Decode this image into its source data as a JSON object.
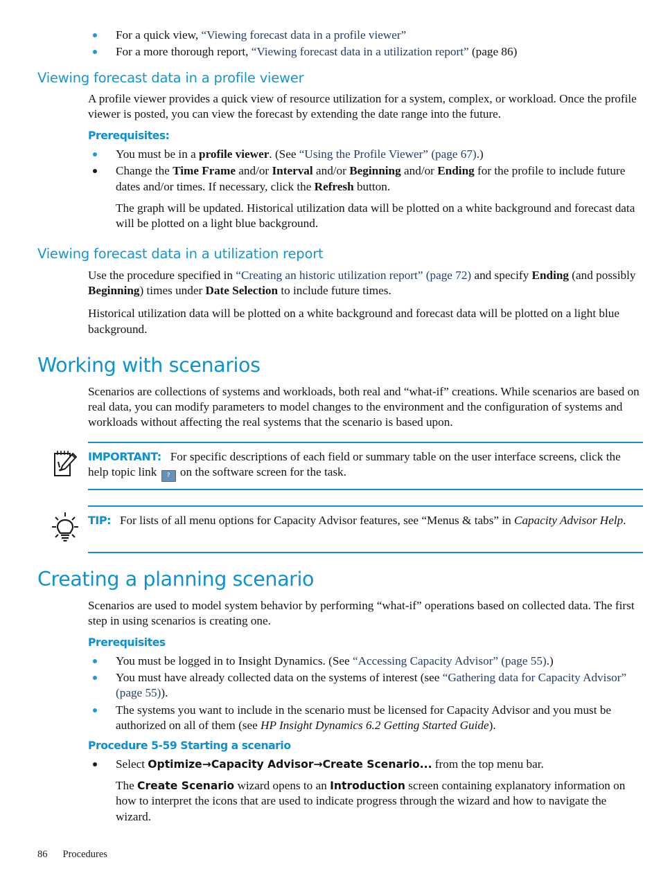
{
  "page": {
    "footer_page_number": "86",
    "footer_chapter": "Procedures"
  },
  "colors": {
    "heading_blue": "#0d92d2",
    "subheading_blue": "#1695d4",
    "link_navy": "#24406b",
    "bullet_blue": "#1e9ad6",
    "rule_blue": "#0e8fd0",
    "body_black": "#141414"
  },
  "intro_bullets": {
    "item1_prefix": "For a quick view, ",
    "item1_link": "“Viewing forecast data in a profile viewer”",
    "item2_prefix": "For a more thorough report, ",
    "item2_link": "“Viewing forecast data in a utilization report”",
    "item2_suffix": " (page 86)"
  },
  "section_profile_viewer": {
    "heading": "Viewing forecast data in a profile viewer",
    "paragraph": "A profile viewer provides a quick view of resource utilization for a system, complex, or workload. Once the profile viewer is posted, you can view the forecast by extending the date range into the future.",
    "prereq_heading": "Prerequisites:",
    "bullet1_a": "You must be in a ",
    "bullet1_b": "profile viewer",
    "bullet1_c": ". (See ",
    "bullet1_link": "“Using the Profile Viewer” (page 67)",
    "bullet1_d": ".)",
    "bullet2_a": "Change the ",
    "bullet2_b1": "Time Frame",
    "bullet2_c1": " and/or ",
    "bullet2_b2": "Interval",
    "bullet2_c2": " and/or ",
    "bullet2_b3": "Beginning",
    "bullet2_c3": " and/or ",
    "bullet2_b4": "Ending",
    "bullet2_d": " for the profile to include future dates and/or times. If necessary, click the ",
    "bullet2_b5": "Refresh",
    "bullet2_e": " button.",
    "bullet2_sub": "The graph will be updated. Historical utilization data will be plotted on a white background and forecast data will be plotted on a light blue background."
  },
  "section_utilization_report": {
    "heading": "Viewing forecast data in a utilization report",
    "para1_a": "Use the procedure specified in ",
    "para1_link": "“Creating an historic utilization report” (page 72)",
    "para1_b": " and specify ",
    "para1_bold1": "Ending",
    "para1_c": " (and possibly ",
    "para1_bold2": "Beginning",
    "para1_d": ") times under ",
    "para1_bold3": "Date Selection",
    "para1_e": " to include future times.",
    "para2": "Historical utilization data will be plotted on a white background and forecast data will be plotted on a light blue background."
  },
  "section_working_with_scenarios": {
    "heading": "Working with scenarios",
    "paragraph": "Scenarios are collections of systems and workloads, both real and “what-if” creations. While scenarios are based on real data, you can modify parameters to model changes to the environment and the configuration of systems and workloads without affecting the real systems that the scenario is based upon.",
    "important": {
      "icon": "notepad-pencil-icon",
      "label": "IMPORTANT:",
      "text_a": "For specific descriptions of each field or summary table on the user interface screens, click the help topic link ",
      "help_icon_glyph": "?",
      "help_icon_name": "help-topic-icon",
      "text_b": " on the software screen for the task."
    },
    "tip": {
      "icon": "lightbulb-icon",
      "label": "TIP:",
      "text_a": "For lists of all menu options for Capacity Advisor features, see “Menus & tabs” in ",
      "text_italic": "Capacity Advisor Help",
      "text_b": "."
    }
  },
  "section_creating_planning_scenario": {
    "heading": "Creating a planning scenario",
    "paragraph": "Scenarios are used to model system behavior by performing “what-if” operations based on collected data. The first step in using scenarios is creating one.",
    "prereq_heading": "Prerequisites",
    "bullet1_a": "You must be logged in to Insight Dynamics. (See ",
    "bullet1_link": "“Accessing Capacity Advisor” (page 55)",
    "bullet1_b": ".)",
    "bullet2_a": "You must have already collected data on the systems of interest (see ",
    "bullet2_link": "“Gathering data for Capacity Advisor” (page 55)",
    "bullet2_b": ").",
    "bullet3_a": "The systems you want to include in the scenario must be licensed for Capacity Advisor and you must be authorized on all of them (see ",
    "bullet3_italic": "HP Insight Dynamics 6.2 Getting Started Guide",
    "bullet3_b": ").",
    "procedure_heading": "Procedure 5-59 Starting a scenario",
    "proc_bullet_a": "Select ",
    "proc_bullet_bold": "Optimize→Capacity Advisor→Create Scenario...",
    "proc_bullet_b": " from the top menu bar.",
    "proc_sub_a": "The ",
    "proc_sub_bold1": "Create Scenario",
    "proc_sub_b": " wizard opens to an ",
    "proc_sub_bold2": "Introduction",
    "proc_sub_c": " screen containing explanatory information on how to interpret the icons that are used to indicate progress through the wizard and how to navigate the wizard."
  }
}
